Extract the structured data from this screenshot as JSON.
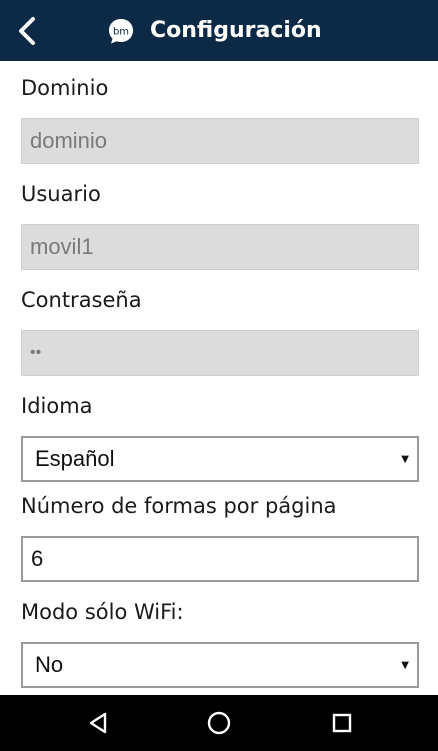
{
  "header": {
    "title": "Configuración",
    "logo_text": "bm",
    "back_icon": "chevron-left-icon",
    "background": "#0c2a45"
  },
  "form": {
    "domain": {
      "label": "Dominio",
      "value": "dominio"
    },
    "user": {
      "label": "Usuario",
      "value": "movil1"
    },
    "password": {
      "label": "Contraseña",
      "value": "••"
    },
    "language": {
      "label": "Idioma",
      "value": "Español"
    },
    "forms_per_page": {
      "label": "Número de formas por página",
      "value": "6"
    },
    "wifi_only": {
      "label": "Modo sólo WiFi:",
      "value": "No"
    }
  },
  "navbar": {
    "back_icon": "triangle-back-icon",
    "home_icon": "circle-home-icon",
    "recents_icon": "square-recents-icon"
  }
}
